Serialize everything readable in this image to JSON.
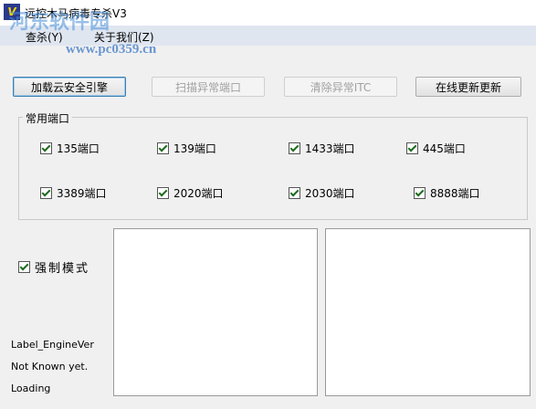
{
  "window": {
    "icon_text": "V",
    "title": "远控木马病毒专杀V3",
    "watermark": "河东软件园",
    "watermark_url": "www.pc0359.cn"
  },
  "menu": [
    {
      "label": "查杀(Y)"
    },
    {
      "label": "关于我们(Z)"
    }
  ],
  "buttons": {
    "load_engine": "加载云安全引擎",
    "scan_ports": "扫描异常端口",
    "clear_itc": "清除异常ITC",
    "update": "在线更新更新"
  },
  "ports_group": {
    "title": "常用端口",
    "items": [
      {
        "label": "135端口",
        "checked": true
      },
      {
        "label": "139端口",
        "checked": true
      },
      {
        "label": "1433端口",
        "checked": true
      },
      {
        "label": "445端口",
        "checked": true
      },
      {
        "label": "3389端口",
        "checked": true
      },
      {
        "label": "2020端口",
        "checked": true
      },
      {
        "label": "2030端口",
        "checked": true
      },
      {
        "label": "8888端口",
        "checked": true
      }
    ]
  },
  "force_mode": {
    "label": "强制模式",
    "checked": true
  },
  "status": {
    "engine_label": "Label_EngineVer",
    "known": "Not Known yet.",
    "loading": "Loading"
  }
}
